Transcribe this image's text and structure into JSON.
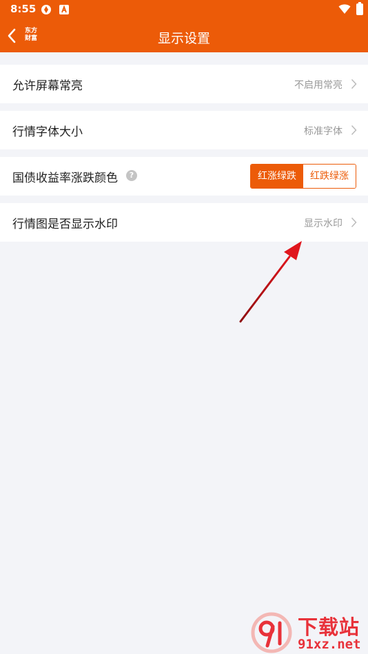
{
  "status_bar": {
    "time": "8:55"
  },
  "nav": {
    "logo_line1": "东方",
    "logo_line2": "财富",
    "title": "显示设置"
  },
  "settings": [
    {
      "label": "允许屏幕常亮",
      "value": "不启用常亮"
    },
    {
      "label": "行情字体大小",
      "value": "标准字体"
    },
    {
      "label": "国债收益率涨跌颜色",
      "options": [
        "红涨绿跌",
        "红跌绿涨"
      ],
      "selected": "红涨绿跌"
    },
    {
      "label": "行情图是否显示水印",
      "value": "显示水印"
    }
  ],
  "colors": {
    "accent": "#ec5b08",
    "arrow": "#e0161d"
  },
  "watermark": {
    "title": "下载站",
    "url": "91xz.net"
  }
}
